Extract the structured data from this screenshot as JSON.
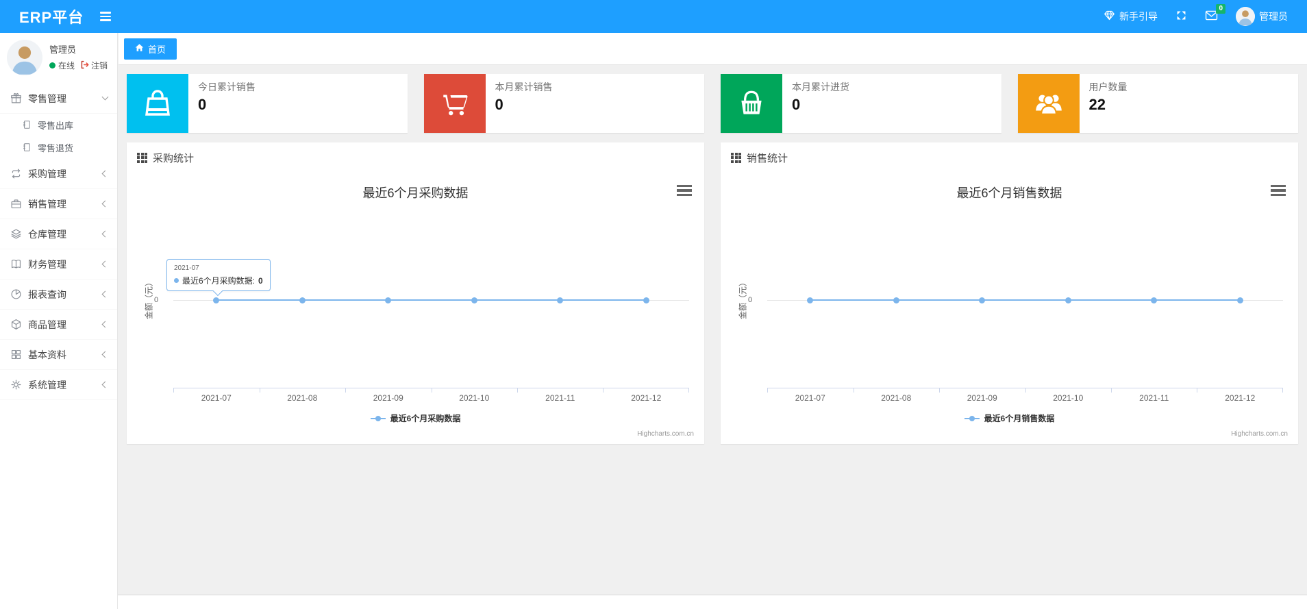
{
  "navbar": {
    "brand": "ERP平台",
    "guide_label": "新手引导",
    "mail_badge": "0",
    "username": "管理员"
  },
  "tabbar": {
    "home_tab": "首页"
  },
  "sidebar": {
    "user": {
      "name": "管理员",
      "status": "在线",
      "logout": "注销"
    },
    "menu": [
      {
        "label": "零售管理",
        "icon": "gift-icon",
        "expanded": true,
        "children": [
          "零售出库",
          "零售退货"
        ]
      },
      {
        "label": "采购管理",
        "icon": "repeat-icon"
      },
      {
        "label": "销售管理",
        "icon": "briefcase-icon"
      },
      {
        "label": "仓库管理",
        "icon": "layers-icon"
      },
      {
        "label": "财务管理",
        "icon": "book-icon"
      },
      {
        "label": "报表查询",
        "icon": "pie-chart-icon"
      },
      {
        "label": "商品管理",
        "icon": "cube-icon"
      },
      {
        "label": "基本资料",
        "icon": "grid-icon"
      },
      {
        "label": "系统管理",
        "icon": "gear-icon"
      }
    ]
  },
  "stat_cards": [
    {
      "label": "今日累计销售",
      "value": "0",
      "color": "#00c0ef",
      "icon": "shopping-bag-icon"
    },
    {
      "label": "本月累计销售",
      "value": "0",
      "color": "#dd4b39",
      "icon": "shopping-cart-icon"
    },
    {
      "label": "本月累计进货",
      "value": "0",
      "color": "#00a65a",
      "icon": "shopping-basket-icon"
    },
    {
      "label": "用户数量",
      "value": "22",
      "color": "#f39c12",
      "icon": "users-icon"
    }
  ],
  "chart_data": [
    {
      "type": "line",
      "panel_title": "采购统计",
      "title": "最近6个月采购数据",
      "categories": [
        "2021-07",
        "2021-08",
        "2021-09",
        "2021-10",
        "2021-11",
        "2021-12"
      ],
      "series": [
        {
          "name": "最近6个月采购数据",
          "values": [
            0,
            0,
            0,
            0,
            0,
            0
          ]
        }
      ],
      "ylabel": "金额（元）",
      "ytick_labels": [
        "0"
      ],
      "ylim": [
        -1,
        1
      ],
      "grid": "single zero line",
      "legend_label": "最近6个月采购数据",
      "legend_position": "bottom-center",
      "line_color": "#7cb5ec",
      "credits": "Highcharts.com.cn",
      "tooltip": {
        "header": "2021-07",
        "label": "最近6个月采购数据:",
        "value": "0"
      }
    },
    {
      "type": "line",
      "panel_title": "销售统计",
      "title": "最近6个月销售数据",
      "categories": [
        "2021-07",
        "2021-08",
        "2021-09",
        "2021-10",
        "2021-11",
        "2021-12"
      ],
      "series": [
        {
          "name": "最近6个月销售数据",
          "values": [
            0,
            0,
            0,
            0,
            0,
            0
          ]
        }
      ],
      "ylabel": "金额（元）",
      "ytick_labels": [
        "0"
      ],
      "ylim": [
        -1,
        1
      ],
      "grid": "single zero line",
      "legend_label": "最近6个月销售数据",
      "legend_position": "bottom-center",
      "line_color": "#7cb5ec",
      "credits": "Highcharts.com.cn"
    }
  ]
}
